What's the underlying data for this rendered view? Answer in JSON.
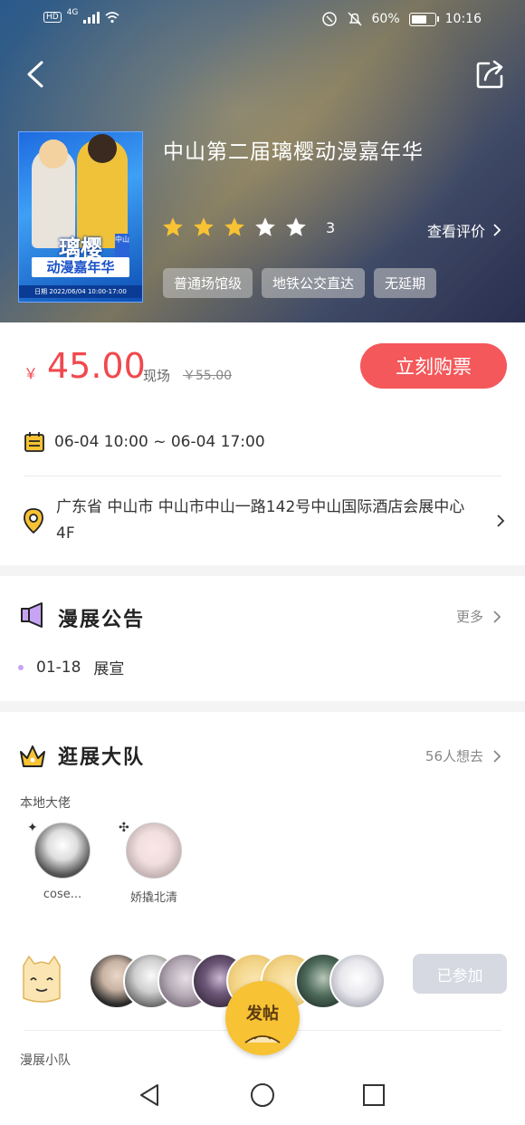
{
  "status_bar": {
    "left_badge": "HD",
    "network": "4G",
    "battery_pct": "60%",
    "time": "10:16"
  },
  "event": {
    "title": "中山第二届璃樱动漫嘉年华",
    "rating_stars": 3,
    "rating_text": "3",
    "reviews_label": "查看评价",
    "tags": [
      "普通场馆级",
      "地铁公交直达",
      "无延期"
    ],
    "poster": {
      "title": "璃樱",
      "subtitle": "动漫嘉年华",
      "city": "中山",
      "info": "日期 2022/06/04 10:00-17:00"
    }
  },
  "price": {
    "currency": "￥",
    "amount": "45.00",
    "spot_label": "现场",
    "original": "￥55.00",
    "buy_label": "立刻购票"
  },
  "date_text": "06-04 10:00 ~ 06-04 17:00",
  "address": "广东省 中山市 中山市中山一路142号中山国际酒店会展中心4F",
  "notice": {
    "title": "漫展公告",
    "more": "更多",
    "items": [
      {
        "date": "01-18",
        "text": "展宣"
      }
    ]
  },
  "team": {
    "title": "逛展大队",
    "count": "56人想去",
    "local_label": "本地大佬",
    "members": [
      {
        "name": "cose..."
      },
      {
        "name": "娇撬北清"
      }
    ],
    "joined_label": "已参加",
    "squad_label": "漫展小队"
  },
  "fab_label": "发帖"
}
